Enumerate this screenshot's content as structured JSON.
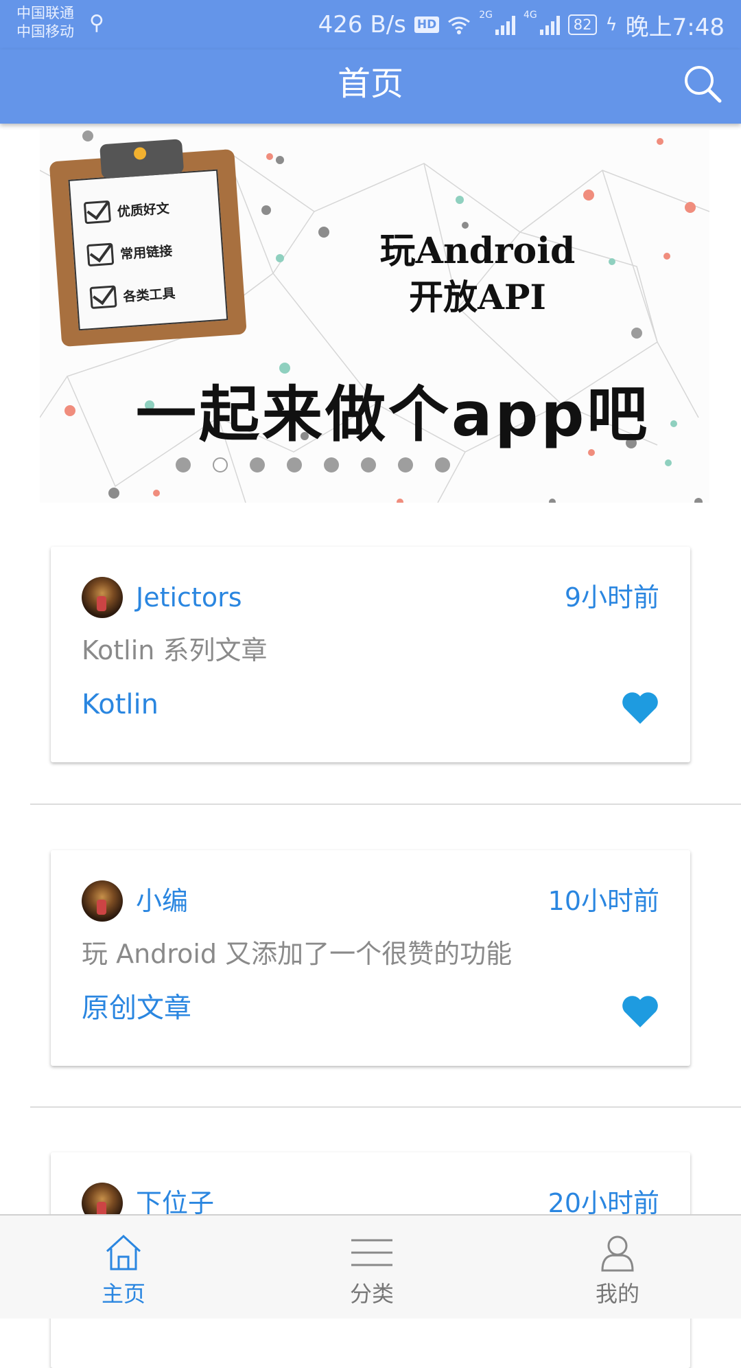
{
  "status_bar": {
    "carrier1": "中国联通",
    "carrier2": "中国移动",
    "speed": "426 B/s",
    "hd": "HD",
    "net1": "2G",
    "net2": "4G",
    "battery": "82",
    "time": "晚上7:48"
  },
  "app_bar": {
    "title": "首页"
  },
  "banner": {
    "line1": "玩Android",
    "line2": "开放API",
    "slogan": "一起来做个app吧",
    "clipboard_items": [
      "优质好文",
      "常用链接",
      "各类工具"
    ],
    "active_page": 2,
    "page_count": 8
  },
  "articles": [
    {
      "author": "Jetictors",
      "time": "9小时前",
      "desc": "Kotlin 系列文章",
      "tag": "Kotlin"
    },
    {
      "author": "小编",
      "time": "10小时前",
      "desc": "玩 Android 又添加了一个很赞的功能",
      "tag": "原创文章"
    },
    {
      "author": "下位子",
      "time": "20小时前",
      "desc": "",
      "tag": ""
    }
  ],
  "bottom_nav": {
    "items": [
      {
        "label": "主页",
        "icon": "home-icon"
      },
      {
        "label": "分类",
        "icon": "menu-icon"
      },
      {
        "label": "我的",
        "icon": "person-icon"
      }
    ],
    "active_index": 0
  },
  "colors": {
    "primary": "#6495e9",
    "accent": "#2a86e0",
    "heart": "#1e9be0",
    "inactive": "#777777"
  }
}
